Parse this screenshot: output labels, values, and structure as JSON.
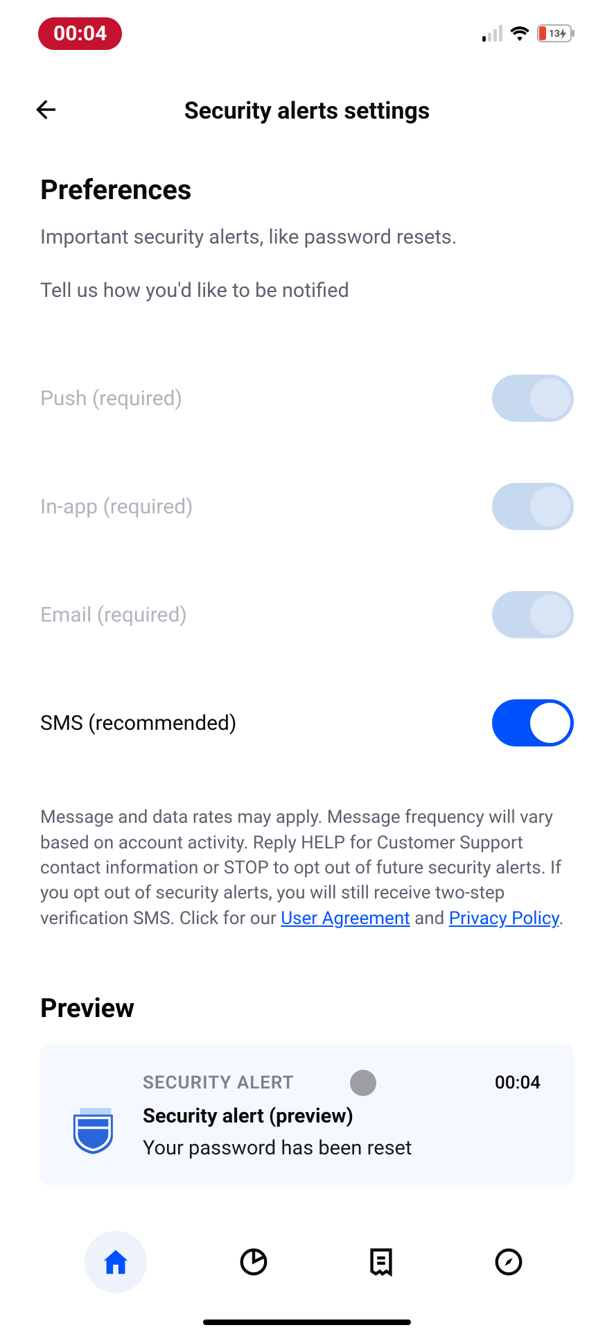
{
  "statusBar": {
    "time": "00:04",
    "batteryPercent": "13"
  },
  "header": {
    "title": "Security alerts settings"
  },
  "preferences": {
    "title": "Preferences",
    "desc": "Important security alerts, like password resets.",
    "subDesc": "Tell us how you'd like to be notified",
    "items": [
      {
        "label": "Push (required)"
      },
      {
        "label": "In-app (required)"
      },
      {
        "label": "Email (required)"
      },
      {
        "label": "SMS (recommended)"
      }
    ]
  },
  "disclaimer": {
    "p1": "Message and data rates may apply. Message frequency will vary based on account activity. Reply HELP for Customer Support contact information or STOP to opt out of future security alerts. If you opt out of security alerts, you will still receive two-step verification SMS. Click for our ",
    "link1": "User Agreement",
    "and": " and ",
    "link2": "Privacy Policy",
    "period": "."
  },
  "preview": {
    "title": "Preview",
    "category": "SECURITY ALERT",
    "timestamp": "00:04",
    "heading": "Security alert (preview)",
    "message": "Your password has been reset"
  }
}
